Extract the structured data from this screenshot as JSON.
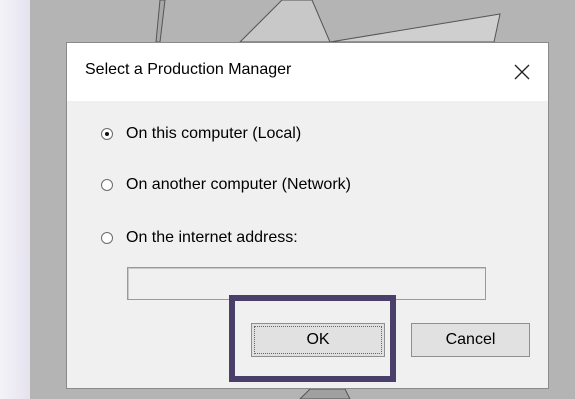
{
  "dialog": {
    "title": "Select a Production Manager",
    "close_icon": "close-icon",
    "options": [
      {
        "label": "On this computer (Local)",
        "checked": true
      },
      {
        "label": "On another computer (Network)",
        "checked": false
      },
      {
        "label": "On the internet address:",
        "checked": false
      }
    ],
    "address_value": "",
    "buttons": {
      "ok": "OK",
      "cancel": "Cancel"
    }
  },
  "colors": {
    "highlight_border": "#4a3f6b",
    "dialog_bg": "#f0f0f0",
    "background": "#b4b4b4"
  }
}
